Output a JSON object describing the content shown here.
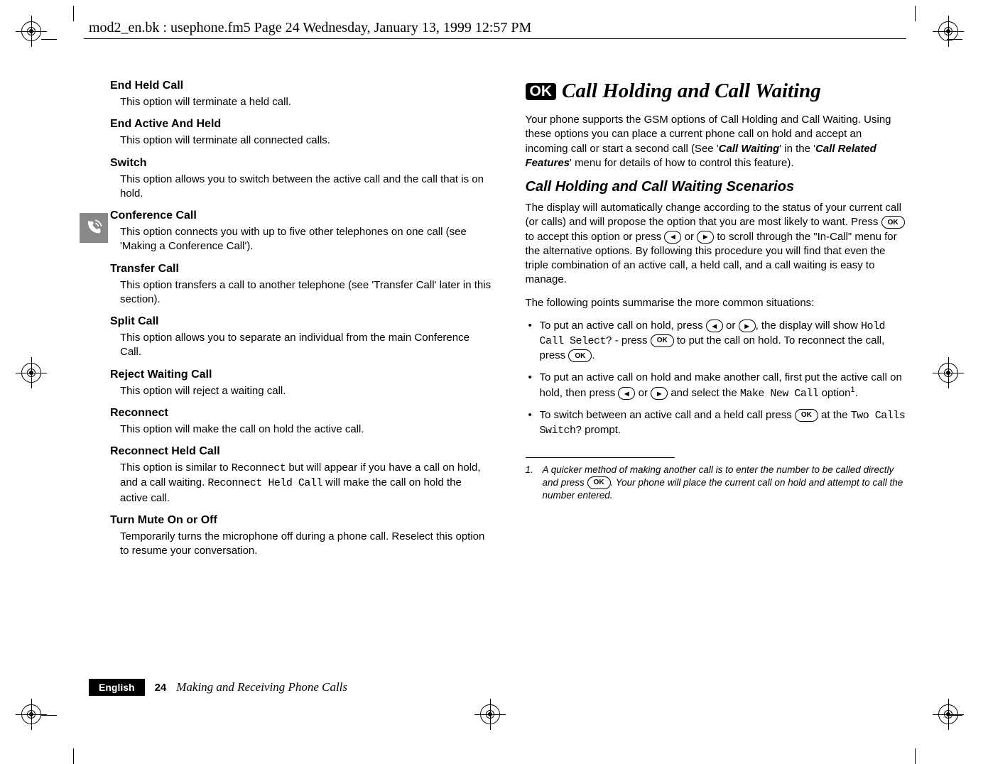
{
  "header": "mod2_en.bk : usephone.fm5  Page 24  Wednesday, January 13, 1999  12:57 PM",
  "left": {
    "s1": {
      "h": "End Held Call",
      "t": "This option will terminate a held call."
    },
    "s2": {
      "h": "End Active And Held",
      "t": "This option will terminate all connected calls."
    },
    "s3": {
      "h": "Switch",
      "t": "This option allows you to switch between the active call and the call that is on hold."
    },
    "s4": {
      "h": "Conference Call",
      "t": "This option connects you with up to five other telephones on one call (see 'Making a Conference Call')."
    },
    "s5": {
      "h": "Transfer Call",
      "t": "This option transfers a call to another telephone (see 'Transfer Call' later in this section)."
    },
    "s6": {
      "h": "Split Call",
      "t": "This option allows you to separate an individual from the main Conference Call."
    },
    "s7": {
      "h": "Reject Waiting Call",
      "t": "This option will reject a waiting call."
    },
    "s8": {
      "h": "Reconnect",
      "t": "This option will make the call on hold the active call."
    },
    "s9": {
      "h": "Reconnect Held Call",
      "t1": "This option is similar to ",
      "code1": "Reconnect",
      "t2": " but will appear if you have a call on hold, and a call waiting. ",
      "code2": "Reconnect Held Call",
      "t3": " will make the call on hold the active call."
    },
    "s10": {
      "h": "Turn Mute On or Off",
      "t": "Temporarily turns the microphone off during a phone call. Reselect this option to resume your conversation."
    }
  },
  "right": {
    "ok": "OK",
    "title": "Call Holding and Call Waiting",
    "p1a": "Your phone supports the GSM options of Call Holding and Call Waiting. Using these options you can place a current phone call on hold and accept an incoming call or start a second call (See '",
    "p1b": "Call Waiting",
    "p1c": "' in the '",
    "p1d": "Call Related Features",
    "p1e": "' menu for details of how to control this feature).",
    "subh": "Call Holding and Call Waiting Scenarios",
    "p2a": "The display will automatically change according to the status of your current call (or calls) and will propose the option that you are most likely to want. Press ",
    "p2b": " to accept this option or press ",
    "p2c": " or ",
    "p2d": " to scroll through the \"In-Call\" menu for the alternative options. By following this procedure you will find that even the triple combination of an active call, a held call, and a call waiting is easy to manage.",
    "p3": "The following points summarise the more common situations:",
    "b1a": "To put an active call on hold, press ",
    "b1b": " or ",
    "b1c": ", the display will show ",
    "b1code": "Hold Call Select?",
    "b1d": " - press ",
    "b1e": " to put the call on hold. To reconnect the call, press ",
    "b1f": ".",
    "b2a": "To put an active call on hold and make another call, first put the active call on hold, then press ",
    "b2b": " or ",
    "b2c": " and select the ",
    "b2code": "Make New Call",
    "b2d": " option",
    "b2e": ".",
    "b3a": "To switch between an active call and a held call press ",
    "b3b": " at the ",
    "b3code": "Two Calls Switch?",
    "b3c": " prompt.",
    "fn_num": "1.",
    "fna": "A quicker method of making another call is to enter the number to be called directly and press ",
    "fnb": ". Your phone will place the current call on hold and attempt to call the number entered."
  },
  "keys": {
    "ok": "OK",
    "left": "◂",
    "right": "▸"
  },
  "footer": {
    "lang": "English",
    "page": "24",
    "title": "Making and Receiving Phone Calls"
  }
}
